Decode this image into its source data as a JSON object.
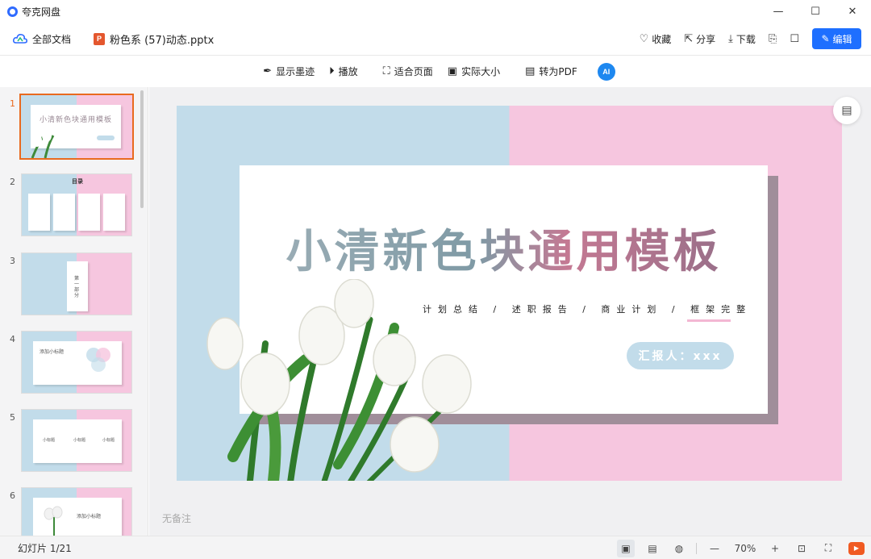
{
  "app": {
    "title": "夸克网盘"
  },
  "window": {
    "minimize": "—",
    "maximize": "☐",
    "close": "✕"
  },
  "header": {
    "all_docs": "全部文档",
    "file_name": "粉色系 (57)动态.pptx",
    "file_icon_letter": "P",
    "favorite": "收藏",
    "share": "分享",
    "download": "下载",
    "edit": "编辑"
  },
  "toolbar": {
    "show_ink": "显示墨迹",
    "play": "播放",
    "fit_page": "适合页面",
    "actual_size": "实际大小",
    "to_pdf": "转为PDF",
    "ai": "AI"
  },
  "thumbnails": {
    "items": [
      {
        "num": "1",
        "title": "小清新色块通用模板"
      },
      {
        "num": "2",
        "title": "目录"
      },
      {
        "num": "3",
        "title": "第一部分"
      },
      {
        "num": "4",
        "title": "添加小标题"
      },
      {
        "num": "5",
        "title": "小标题"
      },
      {
        "num": "6",
        "title": "添加小标题"
      }
    ]
  },
  "slide": {
    "title": "小清新色块通用模板",
    "subtitle": "计划总结 / 述职报告 / 商业计划 / 框架完整",
    "reporter": "汇报人：xxx"
  },
  "notes": {
    "placeholder": "无备注"
  },
  "status": {
    "slide_count": "幻灯片 1/21",
    "zoom": "70%"
  },
  "colors": {
    "accent": "#1e6fff",
    "active_thumb": "#e96a1f",
    "slide_blue": "#c2dcea",
    "slide_pink": "#f6c6df"
  }
}
